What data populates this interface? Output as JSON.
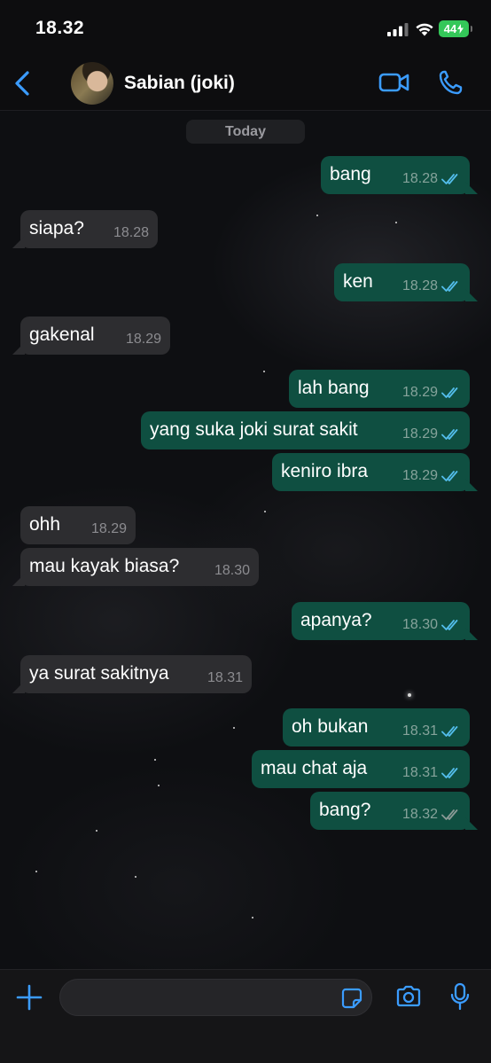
{
  "status_bar": {
    "time": "18.32",
    "battery": "44"
  },
  "header": {
    "contact_name": "Sabian (joki)"
  },
  "date_chip": "Today",
  "messages": [
    {
      "dir": "out",
      "text": "bang",
      "time": "18.28",
      "status": "read"
    },
    {
      "dir": "in",
      "text": "siapa?",
      "time": "18.28"
    },
    {
      "dir": "out",
      "text": "ken",
      "time": "18.28",
      "status": "read"
    },
    {
      "dir": "in",
      "text": "gakenal",
      "time": "18.29"
    },
    {
      "dir": "out",
      "text": "lah bang",
      "time": "18.29",
      "status": "read"
    },
    {
      "dir": "out",
      "text": "yang suka joki surat sakit",
      "time": "18.29",
      "status": "read"
    },
    {
      "dir": "out",
      "text": "keniro ibra",
      "time": "18.29",
      "status": "read"
    },
    {
      "dir": "in",
      "text": "ohh",
      "time": "18.29"
    },
    {
      "dir": "in",
      "text": "mau kayak biasa?",
      "time": "18.30"
    },
    {
      "dir": "out",
      "text": "apanya?",
      "time": "18.30",
      "status": "read"
    },
    {
      "dir": "in",
      "text": "ya surat sakitnya",
      "time": "18.31"
    },
    {
      "dir": "out",
      "text": "oh bukan",
      "time": "18.31",
      "status": "read"
    },
    {
      "dir": "out",
      "text": "mau chat aja",
      "time": "18.31",
      "status": "read"
    },
    {
      "dir": "out",
      "text": "bang?",
      "time": "18.32",
      "status": "delivered"
    }
  ],
  "composer": {
    "value": "",
    "placeholder": ""
  },
  "colors": {
    "accent": "#3b9cff",
    "outgoing_bubble": "#0f4f41",
    "incoming_bubble": "#2d2d30",
    "read_ticks": "#53bdeb",
    "delivered_ticks": "#8a9a96",
    "battery": "#34c759"
  }
}
